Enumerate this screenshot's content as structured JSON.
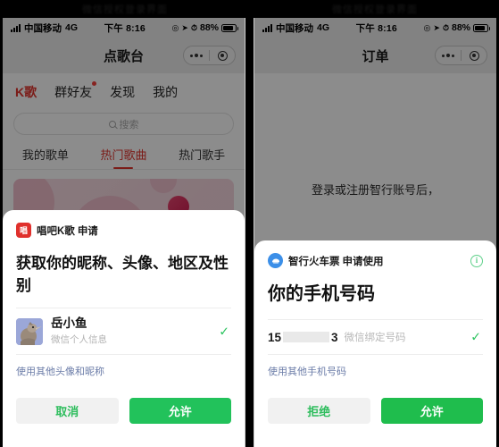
{
  "watermark": {
    "left": "微信授权登录界面",
    "right": "微信授权登录界面"
  },
  "status_bar": {
    "carrier": "中国移动",
    "network": "4G",
    "time": "下午 8:16",
    "battery_percent": "88%",
    "icons": [
      "signal-bars-icon",
      "location-arrow-icon",
      "alarm-icon",
      "battery-icon"
    ]
  },
  "left_phone": {
    "nav": {
      "title": "点歌台",
      "more_icon": "more-dots-icon",
      "capsule_icon": "target-icon"
    },
    "app_tabs": [
      {
        "label": "K歌",
        "active": true,
        "badge": false
      },
      {
        "label": "群好友",
        "active": false,
        "badge": true
      },
      {
        "label": "发现",
        "active": false,
        "badge": false
      },
      {
        "label": "我的",
        "active": false,
        "badge": false
      }
    ],
    "search": {
      "placeholder": "搜索",
      "icon": "search-icon"
    },
    "sub_tabs": [
      {
        "label": "我的歌单",
        "active": false
      },
      {
        "label": "热门歌曲",
        "active": true
      },
      {
        "label": "热门歌手",
        "active": false
      }
    ],
    "banner": {
      "icon": "music-note-icon"
    },
    "sheet": {
      "app_icon_label": "唱",
      "app_name": "唱吧K歌",
      "action": "申请",
      "title": "获取你的昵称、头像、地区及性别",
      "account": {
        "avatar_icon": "bird-avatar",
        "name": "岳小鱼",
        "subtitle": "微信个人信息",
        "selected_icon": "check-icon"
      },
      "alt_link": "使用其他头像和昵称",
      "buttons": {
        "secondary": "取消",
        "primary": "允许"
      }
    }
  },
  "right_phone": {
    "nav": {
      "title": "订单",
      "more_icon": "more-dots-icon",
      "capsule_icon": "target-icon"
    },
    "background_text": "登录或注册智行账号后，",
    "sheet": {
      "app_icon_label": "train-icon",
      "app_name": "智行火车票",
      "action": "申请使用",
      "info_icon": "info-circle-icon",
      "title": "你的手机号码",
      "phone": {
        "prefix": "15",
        "redacted": true,
        "suffix": "3",
        "meta": "微信绑定号码",
        "selected_icon": "check-icon"
      },
      "alt_link": "使用其他手机号码",
      "buttons": {
        "secondary": "拒绝",
        "primary": "允许"
      }
    }
  },
  "colors": {
    "wechat_green": "#22c25b",
    "accent_red": "#e1332d",
    "link_blue": "#6b7ca8",
    "chang_icon_red": "#e0302c",
    "zhixing_blue": "#3c8fe8",
    "info_green": "#5fd08a"
  }
}
